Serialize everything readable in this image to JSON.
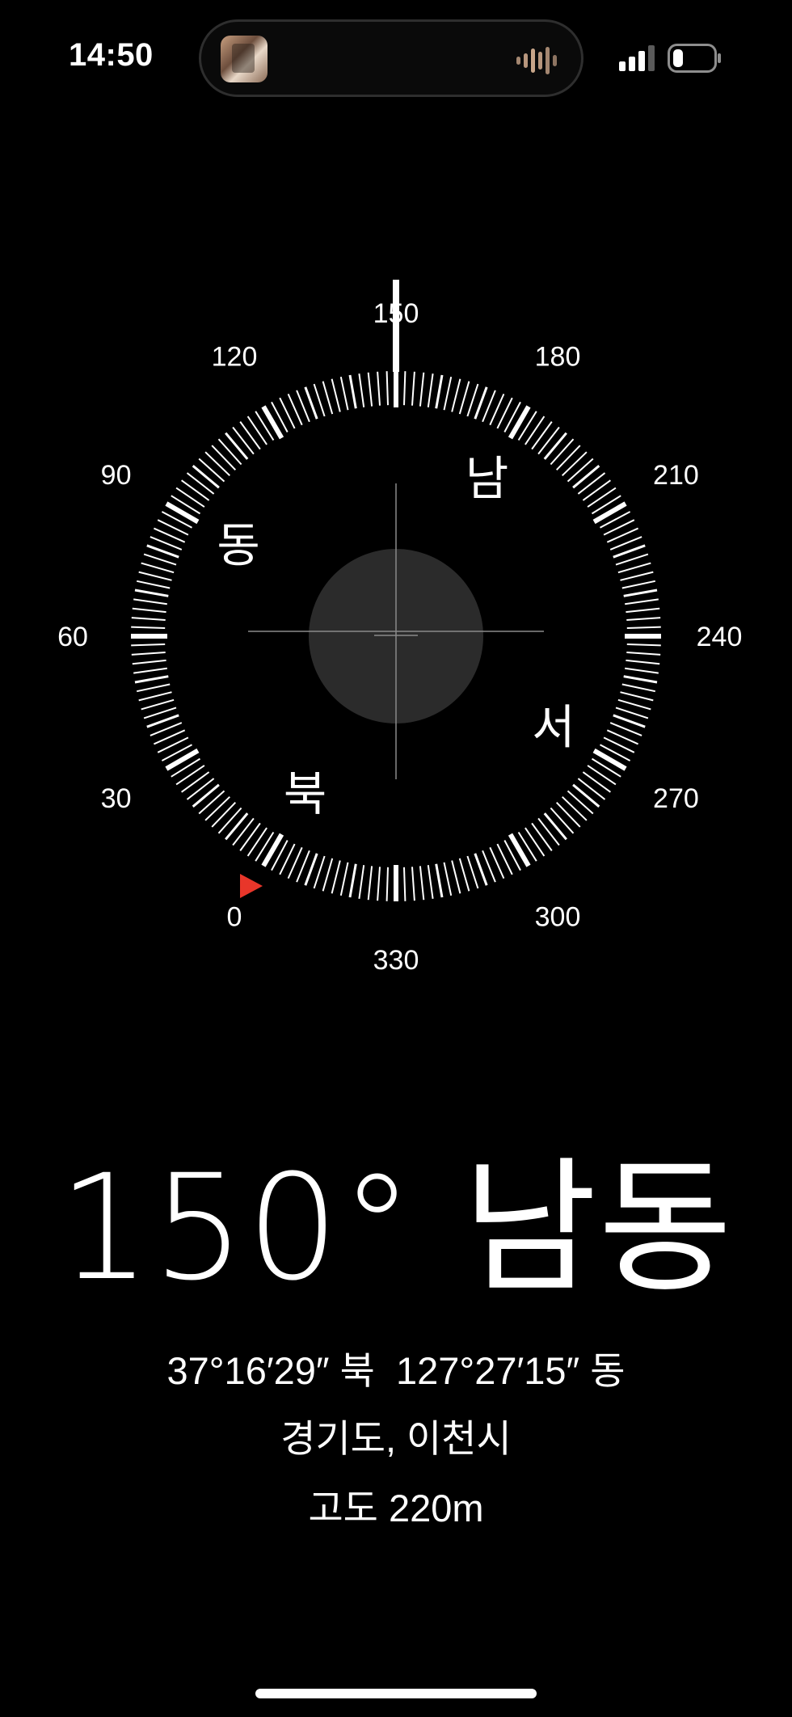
{
  "status_bar": {
    "time": "14:50",
    "icons": [
      "now-playing-thumbnail",
      "audio-waveform-icon",
      "cellular-signal-icon",
      "battery-icon"
    ],
    "battery_level": 0.25
  },
  "compass": {
    "heading_value": 150,
    "degree_labels": [
      "0",
      "30",
      "60",
      "90",
      "120",
      "150",
      "180",
      "210",
      "240",
      "270",
      "300",
      "330"
    ],
    "cardinal_labels": {
      "north": "북",
      "east": "동",
      "south": "남",
      "west": "서"
    },
    "north_marker_color": "#e8362a"
  },
  "readout": {
    "heading": "150° 남동",
    "coordinates": "37°16′29″ 북  127°27′15″ 동",
    "location": "경기도, 이천시",
    "altitude": "고도 220m"
  },
  "colors": {
    "background": "#000000",
    "foreground": "#ffffff",
    "center_disc": "#2b2b2b"
  }
}
